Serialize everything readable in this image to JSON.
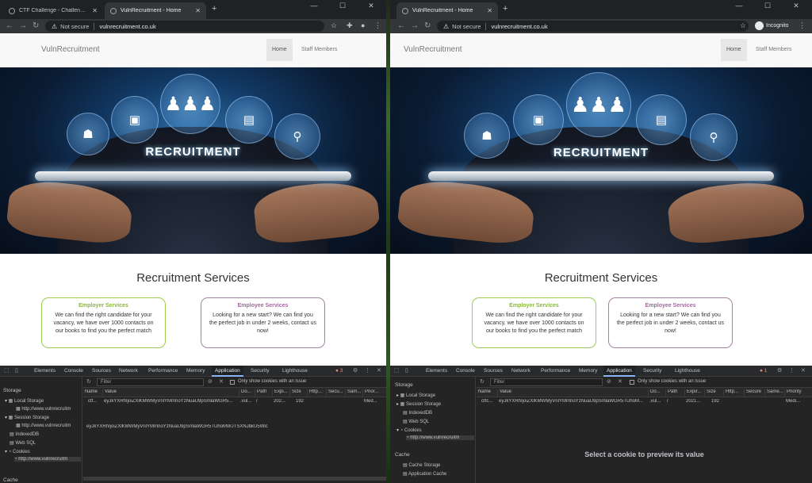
{
  "left": {
    "tabs": [
      {
        "title": "CTF Challenge - Challenge Vuln..."
      },
      {
        "title": "VulnRecruitment - Home"
      }
    ],
    "address": {
      "security": "Not secure",
      "url": "vulnrecruitment.co.uk"
    }
  },
  "right": {
    "tabs": [
      {
        "title": "VulnRecruitment - Home"
      }
    ],
    "address": {
      "security": "Not secure",
      "url": "vulnrecruitment.co.uk"
    },
    "profile": "Incognito"
  },
  "site": {
    "brand": "VulnRecruitment",
    "nav": [
      "Home",
      "Staff Members"
    ],
    "hero_text": "RECRUITMENT",
    "section_title": "Recruitment Services",
    "employer": {
      "title": "Employer Services",
      "text": "We can find the right candidate for your vacancy, we have over 1000 contacts on our books to find you the perfect match"
    },
    "employee": {
      "title": "Employee Services",
      "text": "Looking for a new start? We can find you the perfect job in under 2 weeks, contact us now!"
    }
  },
  "devtools": {
    "tabs": [
      "Elements",
      "Console",
      "Sources",
      "Network",
      "Performance",
      "Memory",
      "Application",
      "Security",
      "Lighthouse"
    ],
    "active_tab": "Application",
    "left_errors": "3",
    "right_errors": "1",
    "filter_placeholder": "Filter",
    "only_issue_label": "Only show cookies with an issue",
    "columns": [
      "Name",
      "Value",
      "Do...",
      "Path",
      "Expi...",
      "Size",
      "Http...",
      "Secu...",
      "Sam...",
      "Prior..."
    ],
    "columns_right": [
      "Name",
      "Value",
      "Do...",
      "Path",
      "Expir...",
      "Size",
      "Http...",
      "Secure",
      "Same...",
      "Priority"
    ],
    "left_row": [
      "ctf...",
      "eyJkYXRhIjoiZXlKMWMyVnlYMmhoYzNuaU9pSmlaWGR5...",
      ".vul...",
      "/",
      "202...",
      "192",
      "",
      "",
      "",
      "Med..."
    ],
    "right_row": [
      "ctfc...",
      "eyJkYXRhIjoiZXlKMWMyVnlYMmhoYzNuaU9pSmlaWGR5TUhoM...",
      ".vul...",
      "/",
      "2021...",
      "192",
      "",
      "",
      "",
      "Medi..."
    ],
    "left_value": "eyJkYXRhIjoiZXlKMWMyVnlYMmhoYzNuaU9pSmlaWGR5TUhoMWJTSXNJbkU5Wlc",
    "preview_hint": "Select a cookie to preview its value",
    "left_sidebar": {
      "storage": "Storage",
      "local_storage": "Local Storage",
      "local_url": "http://www.vulnrecruitm",
      "session_storage": "Session Storage",
      "session_url": "http://www.vulnrecruitm",
      "indexeddb": "IndexedDB",
      "websql": "Web SQL",
      "cookies": "Cookies",
      "cookies_url": "http://www.vulnrecruitm",
      "cache": "Cache"
    },
    "right_sidebar": {
      "storage": "Storage",
      "local_storage": "Local Storage",
      "session_storage": "Session Storage",
      "indexeddb": "IndexedDB",
      "websql": "Web SQL",
      "cookies": "Cookies",
      "cookies_url": "http://www.vulnrecruitm",
      "cache": "Cache",
      "cache_storage": "Cache Storage",
      "app_cache": "Application Cache"
    }
  }
}
